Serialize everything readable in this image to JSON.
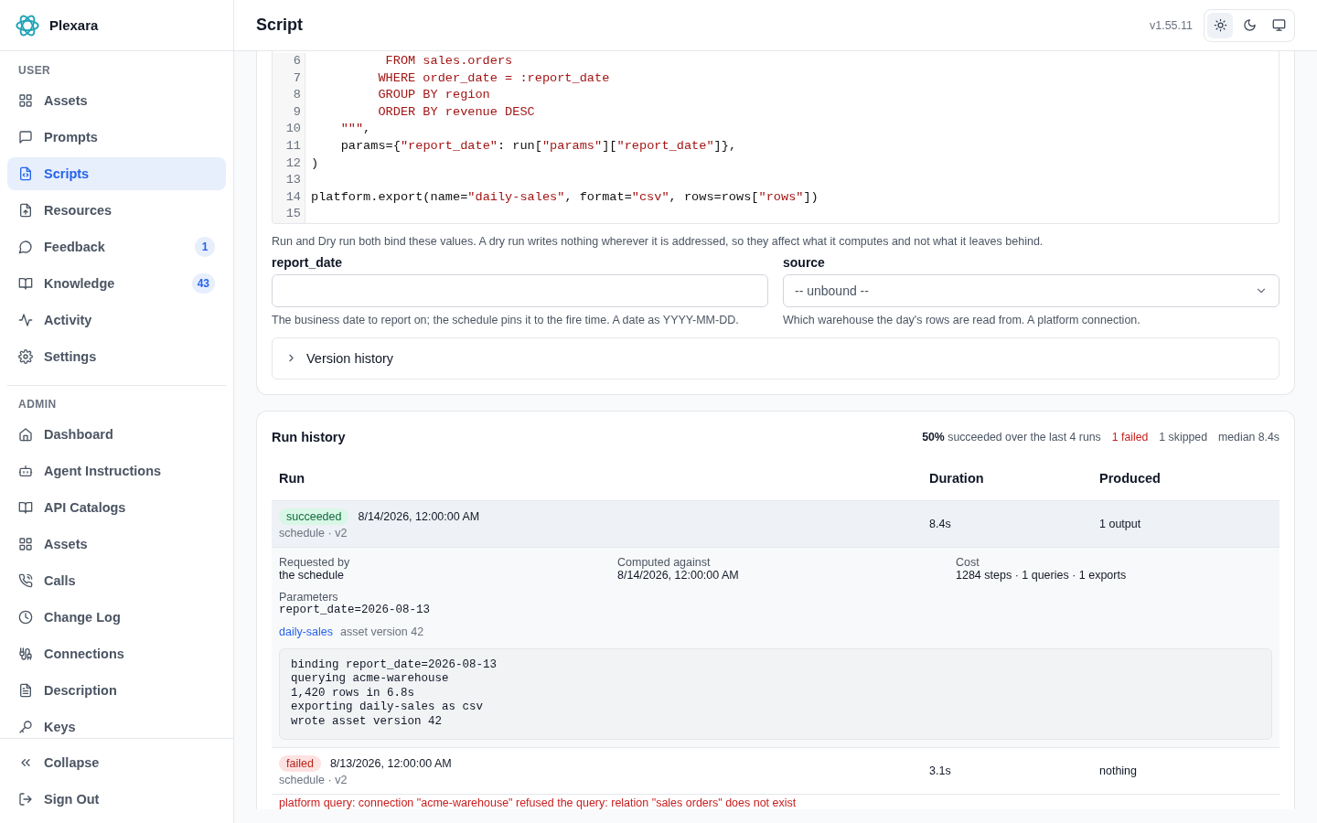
{
  "app": {
    "name": "Plexara"
  },
  "sidebar": {
    "sections": [
      {
        "title": "USER",
        "items": [
          {
            "label": "Assets",
            "selected": false
          },
          {
            "label": "Prompts",
            "selected": false
          },
          {
            "label": "Scripts",
            "selected": true
          },
          {
            "label": "Resources",
            "selected": false
          },
          {
            "label": "Feedback",
            "selected": false,
            "badge": "1"
          },
          {
            "label": "Knowledge",
            "selected": false,
            "badge": "43"
          },
          {
            "label": "Activity",
            "selected": false
          },
          {
            "label": "Settings",
            "selected": false
          }
        ]
      },
      {
        "title": "ADMIN",
        "items": [
          {
            "label": "Dashboard",
            "selected": false
          },
          {
            "label": "Agent Instructions",
            "selected": false
          },
          {
            "label": "API Catalogs",
            "selected": false
          },
          {
            "label": "Assets",
            "selected": false
          },
          {
            "label": "Calls",
            "selected": false
          },
          {
            "label": "Change Log",
            "selected": false
          },
          {
            "label": "Connections",
            "selected": false
          },
          {
            "label": "Description",
            "selected": false
          },
          {
            "label": "Keys",
            "selected": false
          }
        ]
      }
    ],
    "footer": [
      {
        "label": "Collapse"
      },
      {
        "label": "Sign Out"
      }
    ]
  },
  "header": {
    "title": "Script",
    "version": "v1.55.11",
    "theme_options": [
      {
        "selected": true
      },
      {
        "selected": false
      },
      {
        "selected": false
      }
    ]
  },
  "script_card": {
    "code_lines": [
      {
        "number": "6",
        "tokens": [
          {
            "text": "          FROM sales.orders",
            "kind": "string"
          }
        ]
      },
      {
        "number": "7",
        "tokens": [
          {
            "text": "         WHERE order_date = :report_date",
            "kind": "string"
          }
        ]
      },
      {
        "number": "8",
        "tokens": [
          {
            "text": "         GROUP BY region",
            "kind": "string"
          }
        ]
      },
      {
        "number": "9",
        "tokens": [
          {
            "text": "         ORDER BY revenue DESC",
            "kind": "string"
          }
        ]
      },
      {
        "number": "10",
        "tokens": [
          {
            "text": "    \"\"\"",
            "kind": "string"
          },
          {
            "text": ",",
            "kind": "plain"
          }
        ]
      },
      {
        "number": "11",
        "tokens": [
          {
            "text": "    params={",
            "kind": "plain"
          },
          {
            "text": "\"report_date\"",
            "kind": "string"
          },
          {
            "text": ": run[",
            "kind": "plain"
          },
          {
            "text": "\"params\"",
            "kind": "string"
          },
          {
            "text": "][",
            "kind": "plain"
          },
          {
            "text": "\"report_date\"",
            "kind": "string"
          },
          {
            "text": "]},",
            "kind": "plain"
          }
        ]
      },
      {
        "number": "12",
        "tokens": [
          {
            "text": ")",
            "kind": "plain"
          }
        ]
      },
      {
        "number": "13"
      },
      {
        "number": "14",
        "tokens": [
          {
            "text": "platform.export(name=",
            "kind": "plain"
          },
          {
            "text": "\"daily-sales\"",
            "kind": "string"
          },
          {
            "text": ", format=",
            "kind": "plain"
          },
          {
            "text": "\"csv\"",
            "kind": "string"
          },
          {
            "text": ", rows=rows[",
            "kind": "plain"
          },
          {
            "text": "\"rows\"",
            "kind": "string"
          },
          {
            "text": "])",
            "kind": "plain"
          }
        ]
      },
      {
        "number": "15"
      }
    ],
    "note": "Run and Dry run both bind these values. A dry run writes nothing wherever it is addressed, so they affect what it computes and not what it leaves behind.",
    "parameters": [
      {
        "label": "report_date",
        "kind": "text",
        "help": "The business date to report on; the schedule pins it to the fire time. A date as YYYY-MM-DD."
      },
      {
        "label": "source",
        "kind": "select",
        "value": "-- unbound --",
        "help": "Which warehouse the day's rows are read from. A platform connection."
      }
    ],
    "version_history": {
      "label": "Version history",
      "expanded": false
    }
  },
  "run_history": {
    "title": "Run history",
    "summary": [
      {
        "text": "**50%** succeeded over the last 4 runs",
        "kind": "plain"
      },
      {
        "text": "1 failed",
        "kind": "failed"
      },
      {
        "text": "1 skipped",
        "kind": "plain"
      },
      {
        "text": "median 8.4s",
        "kind": "plain"
      }
    ],
    "columns": [
      "Run",
      "Duration",
      "Produced"
    ],
    "runs": [
      {
        "status": "succeeded",
        "kind": "succeeded",
        "time": "8/14/2026, 12:00:00 AM",
        "meta": "schedule · v2",
        "duration": "8.4s",
        "produced": "1 output",
        "expanded": true,
        "details": {
          "fields": [
            {
              "label": "Requested by",
              "value": "the schedule"
            },
            {
              "label": "Computed against",
              "value": "8/14/2026, 12:00:00 AM"
            },
            {
              "label": "Cost",
              "value": "1284 steps · 1 queries · 1 exports"
            }
          ],
          "parameters_label": "Parameters",
          "parameters": "report_date=2026-08-13",
          "asset_link": "daily-sales",
          "asset_version": "asset version 42",
          "log": [
            "binding report_date=2026-08-13",
            "querying acme-warehouse",
            "1,420 rows in 6.8s",
            "exporting daily-sales as csv",
            "wrote asset version 42"
          ]
        }
      },
      {
        "status": "failed",
        "kind": "failed",
        "time": "8/13/2026, 12:00:00 AM",
        "meta": "schedule · v2",
        "duration": "3.1s",
        "produced": "nothing",
        "expanded": false,
        "error": "platform query: connection \"acme-warehouse\" refused the query: relation \"sales orders\" does not exist"
      }
    ]
  }
}
